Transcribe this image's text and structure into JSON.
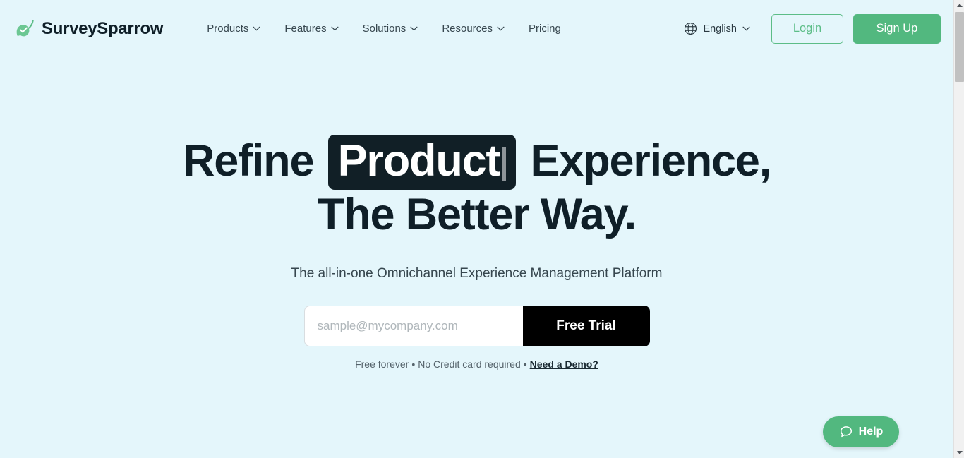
{
  "header": {
    "brand": {
      "name": "SurveySparrow",
      "logo_icon": "sparrow-leaf-check-logo",
      "logo_color": "#5cbd87"
    },
    "nav_items": [
      {
        "label": "Products",
        "has_dropdown": true
      },
      {
        "label": "Features",
        "has_dropdown": true
      },
      {
        "label": "Solutions",
        "has_dropdown": true
      },
      {
        "label": "Resources",
        "has_dropdown": true
      },
      {
        "label": "Pricing",
        "has_dropdown": false
      }
    ],
    "language": {
      "icon": "globe-icon",
      "value": "English",
      "has_dropdown": true
    },
    "login_label": "Login",
    "signup_label": "Sign Up",
    "accent_green": "#52b87f"
  },
  "hero": {
    "headline_line1_before": "Refine",
    "headline_highlight": "Product",
    "headline_line1_after": "Experience,",
    "headline_line2": "The Better Way.",
    "highlight_bg": "#111f26",
    "highlight_color": "#ffffff",
    "subheadline": "The all-in-one Omnichannel Experience Management Platform",
    "form": {
      "email_placeholder": "sample@mycompany.com",
      "email_value": "",
      "submit_label": "Free Trial",
      "submit_bg": "#000000"
    },
    "note": {
      "part1": "Free forever",
      "separator": "•",
      "part2": "No Credit card required",
      "link": "Need a Demo?"
    }
  },
  "help_widget": {
    "label": "Help",
    "icon": "chat-bubble-icon",
    "bg": "#52b87f"
  },
  "page": {
    "background": "#e4f6fb",
    "text_dark": "#0f1f28"
  }
}
